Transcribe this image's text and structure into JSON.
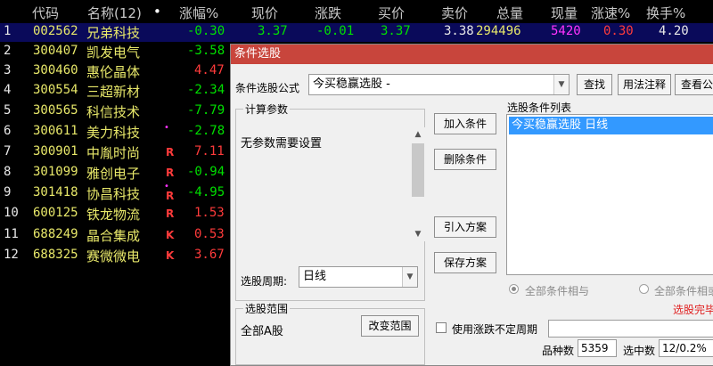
{
  "columns": [
    "代码",
    "名称(12)",
    "•",
    "涨幅%",
    "现价",
    "涨跌",
    "买价",
    "卖价",
    "总量",
    "现量",
    "涨速%",
    "换手%"
  ],
  "rows": [
    {
      "idx": "1",
      "code": "002562",
      "name": "兄弟科技",
      "pct": "-0.30",
      "price": "3.37",
      "chg": "-0.01",
      "bid": "3.37",
      "ask": "3.38",
      "vol": "294496",
      "cur": "5420",
      "speed": "0.30",
      "turn": "4.20",
      "flag": ""
    },
    {
      "idx": "2",
      "code": "300407",
      "name": "凯发电气",
      "pct": "-3.58",
      "flag": ""
    },
    {
      "idx": "3",
      "code": "300460",
      "name": "惠伦晶体",
      "pct": "4.47",
      "flag": ""
    },
    {
      "idx": "4",
      "code": "300554",
      "name": "三超新材",
      "pct": "-2.34",
      "flag": ""
    },
    {
      "idx": "5",
      "code": "300565",
      "name": "科信技术",
      "pct": "-7.79",
      "flag": ""
    },
    {
      "idx": "6",
      "code": "300611",
      "name": "美力科技",
      "pct": "-2.78",
      "flag": "",
      "dot": "•"
    },
    {
      "idx": "7",
      "code": "300901",
      "name": "中胤时尚",
      "pct": "7.11",
      "flag": "R"
    },
    {
      "idx": "8",
      "code": "301099",
      "name": "雅创电子",
      "pct": "-0.94",
      "flag": "R"
    },
    {
      "idx": "9",
      "code": "301418",
      "name": "协昌科技",
      "pct": "-4.95",
      "flag": "R",
      "dot": "•"
    },
    {
      "idx": "10",
      "code": "600125",
      "name": "铁龙物流",
      "pct": "1.53",
      "flag": "R"
    },
    {
      "idx": "11",
      "code": "688249",
      "name": "晶合集成",
      "pct": "0.53",
      "flag": "K"
    },
    {
      "idx": "12",
      "code": "688325",
      "name": "赛微微电",
      "pct": "3.67",
      "flag": "K"
    }
  ],
  "dialog": {
    "title": "条件选股",
    "formula_label": "条件选股公式",
    "formula_value": "今买稳赢选股  -",
    "btn_find": "查找",
    "btn_usage": "用法注释",
    "btn_view": "查看公式",
    "calc_params_title": "计算参数",
    "no_params_text": "无参数需要设置",
    "btn_add": "加入条件",
    "btn_delete": "删除条件",
    "btn_import": "引入方案",
    "btn_save": "保存方案",
    "cond_list_label": "选股条件列表",
    "cond_list_item": "今买稳赢选股  日线",
    "period_label": "选股周期:",
    "period_value": "日线",
    "radio_and": "全部条件相与",
    "radio_or": "全部条件相或",
    "status_text": "选股完毕",
    "range_title": "选股范围",
    "range_value": "全部A股",
    "btn_change_range": "改变范围",
    "variable_period_label": "使用涨跌不定周期",
    "count_label": "品种数",
    "count_value": "5359",
    "selected_label": "选中数",
    "selected_value": "12/0.2%"
  },
  "colors": {
    "up": "#ff3b3b",
    "down": "#00e000",
    "code": "#e8e86a",
    "title_bar": "#c8453c",
    "list_selection": "#3399ff"
  }
}
